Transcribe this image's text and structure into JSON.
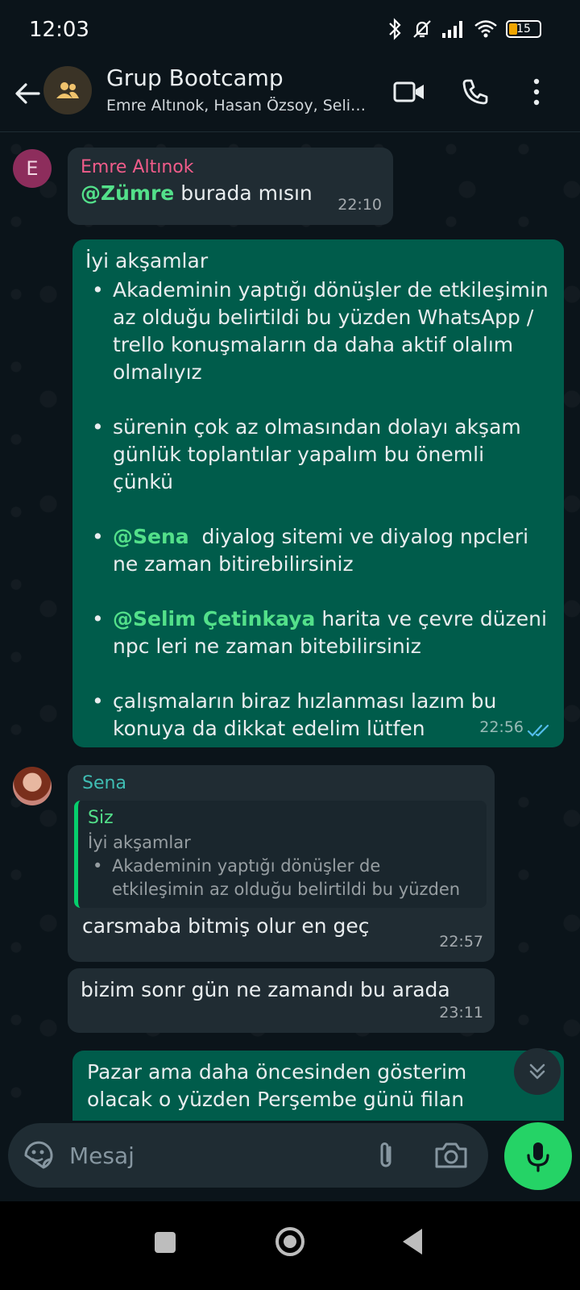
{
  "status_bar": {
    "time": "12:03",
    "battery_level": "15"
  },
  "header": {
    "title": "Grup Bootcamp",
    "subtitle": "Emre Altınok, Hasan Özsoy, Seli…"
  },
  "messages": [
    {
      "sender": "Emre Altınok",
      "sender_color": "#f15c8a",
      "avatar_letter": "E",
      "mention": "@Zümre",
      "text": " burada mısın",
      "time": "22:10"
    },
    {
      "intro": "İyi akşamlar",
      "bullets": [
        {
          "text": "Akademinin yaptığı dönüşler de etkileşimin az olduğu belirtildi bu yüzden WhatsApp / trello konuşmaların da daha aktif olalım olmalıyız"
        },
        {
          "text": "sürenin çok az olmasından dolayı akşam günlük toplantılar yapalım bu önemli çünkü"
        },
        {
          "mention": "@Sena",
          "text": "  diyalog sitemi ve diyalog npcleri ne zaman bitirebilirsiniz"
        },
        {
          "mention": "@Selim Çetinkaya",
          "text": " harita ve çevre düzeni npc leri ne zaman bitebilirsiniz"
        },
        {
          "text": "çalışmaların biraz hızlanması lazım bu konuya da dikkat edelim lütfen"
        }
      ],
      "time": "22:56",
      "read_color": "#53bdeb"
    },
    {
      "sender": "Sena",
      "sender_color": "#3fbdb3",
      "quote": {
        "author": "Siz",
        "line1": "İyi akşamlar",
        "line2": "Akademinin yaptığı dönüşler de",
        "line3": "etkileşimin az olduğu belirtildi bu yüzden"
      },
      "text": "carsmaba bitmiş olur en geç",
      "time": "22:57"
    },
    {
      "text": "bizim sonr gün ne zamandı bu arada",
      "time": "23:11"
    },
    {
      "text": "Pazar ama daha öncesinden gösterim olacak o yüzden Perşembe günü filan"
    }
  ],
  "composer": {
    "placeholder": "Mesaj"
  },
  "colors": {
    "incoming_bubble": "#202c33",
    "outgoing_bubble": "#005c4b",
    "mention": "#53e08a",
    "mic_button": "#25d366"
  }
}
